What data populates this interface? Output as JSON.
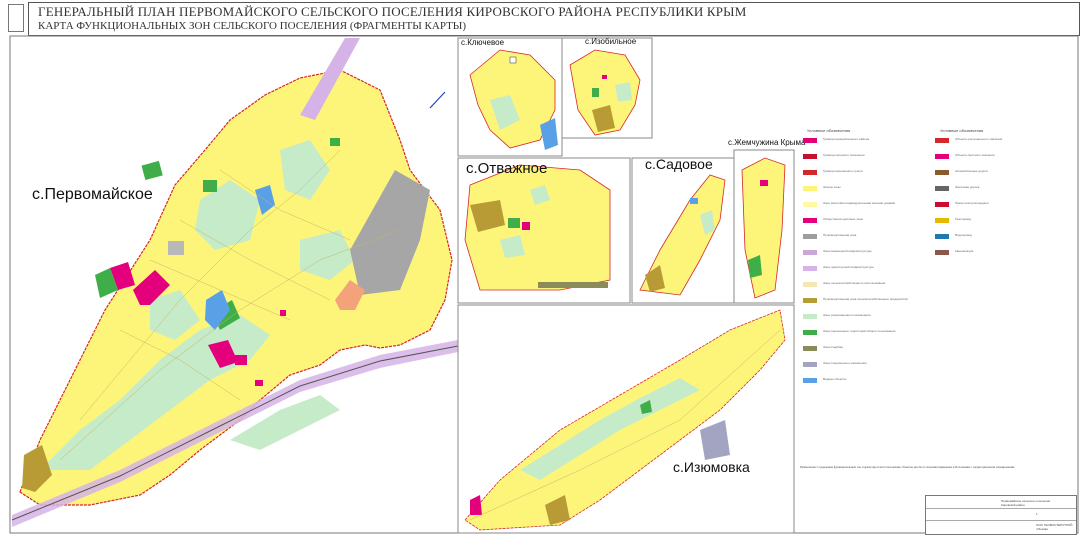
{
  "header": {
    "title": "ГЕНЕРАЛЬНЫЙ ПЛАН ПЕРВОМАЙСКОГО СЕЛЬСКОГО ПОСЕЛЕНИЯ КИРОВСКОГО РАЙОНА РЕСПУБЛИКИ КРЫМ",
    "subtitle": "КАРТА ФУНКЦИОНАЛЬНЫХ ЗОН СЕЛЬСКОГО ПОСЕЛЕНИЯ  (ФРАГМЕНТЫ КАРТЫ)"
  },
  "places": {
    "pervomayskoe": "с.Первомайское",
    "klyuchevoe": "с.Ключевое",
    "izobilnoe": "с.Изобильное",
    "otvazhnoe": "с.Отважное",
    "sadovoe": "с.Садовое",
    "zhemchuzhina": "с.Жемчужина Крыма",
    "izyumovka": "с.Изюмовка"
  },
  "legend": {
    "heading1": "Условные обозначения",
    "heading2": "Условные обозначения",
    "items_left": [
      {
        "label": "Граница муниципального района",
        "color": "#e0007a"
      },
      {
        "label": "Граница сельского поселения",
        "color": "#c8102e"
      },
      {
        "label": "Граница населенного пункта",
        "color": "#d62728"
      },
      {
        "label": "Жилые зоны",
        "color": "#fdf57a"
      },
      {
        "label": "Зона застройки индивидуальными жилыми домами",
        "color": "#fef9a5"
      },
      {
        "label": "Общественно-деловые зоны",
        "color": "#e4007c"
      },
      {
        "label": "Производственная зона",
        "color": "#9e9e9e"
      },
      {
        "label": "Зона инженерной инфраструктуры",
        "color": "#c9a7d9"
      },
      {
        "label": "Зона транспортной инфраструктуры",
        "color": "#d6b3e6"
      },
      {
        "label": "Зоны сельскохозяйственного использования",
        "color": "#f6e6b4"
      },
      {
        "label": "Производственная зона сельскохозяйственных предприятий",
        "color": "#b99b35"
      },
      {
        "label": "Зоны рекреационного назначения",
        "color": "#c6ebc9"
      },
      {
        "label": "Зона озелененных территорий общего пользования",
        "color": "#3fae49"
      },
      {
        "label": "Зона кладбищ",
        "color": "#8c8c5a"
      },
      {
        "label": "Зона специального назначения",
        "color": "#a3a3c2"
      },
      {
        "label": "Водные объекты",
        "color": "#5aa0e6"
      }
    ],
    "items_right": [
      {
        "label": "Объекты регионального значения",
        "color": "#d62728"
      },
      {
        "label": "Объекты местного значения",
        "color": "#e4007c"
      },
      {
        "label": "Автомобильные дороги",
        "color": "#8c5a2e"
      },
      {
        "label": "Железная дорога",
        "color": "#666666"
      },
      {
        "label": "Линии электропередачи",
        "color": "#c8102e"
      },
      {
        "label": "Газопровод",
        "color": "#e6b800"
      },
      {
        "label": "Водопровод",
        "color": "#1f77b4"
      },
      {
        "label": "Канализация",
        "color": "#8c564b"
      }
    ]
  },
  "note": "Примечание: Содержание функциональных зон, параметры и местоположение объектов местного значения приведены в Положении о территориальном планировании.",
  "stamp": {
    "line1": "Первомайское сельское поселение",
    "line2": "Кировский район",
    "org": "ООО ГЕОМАСТЕРСТРОЙ",
    "city": "г.Москва",
    "sheet": "1"
  },
  "colors": {
    "residential": "#fdf57a",
    "green": "#c6ebc9",
    "park": "#3fae49",
    "industrial": "#a6a6a6",
    "public": "#e4007c",
    "agri": "#b99b35",
    "water": "#5aa0e6",
    "transport": "#d6b3e6",
    "border": "#d62728",
    "salmon": "#f3a27a"
  }
}
